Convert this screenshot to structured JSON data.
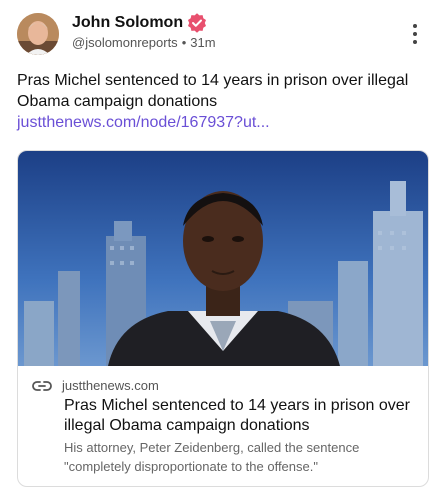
{
  "author": {
    "name": "John Solomon",
    "handle": "@jsolomonreports",
    "time": "31m",
    "separator": "•"
  },
  "post": {
    "text": "Pras Michel sentenced to 14 years in prison over illegal Obama campaign donations ",
    "link_text": "justthenews.com/node/167937?ut..."
  },
  "card": {
    "domain": "justthenews.com",
    "title": "Pras Michel sentenced to 14 years in prison over illegal Obama campaign donations",
    "description": "His attorney, Peter Zeidenberg, called the sentence \"completely disproportionate to the offense.\""
  },
  "colors": {
    "link": "#6a4fd6",
    "verified_badge": "#e8506e"
  },
  "icons": {
    "verified": "verified-badge-icon",
    "more": "more-options-icon",
    "link": "link-icon"
  }
}
